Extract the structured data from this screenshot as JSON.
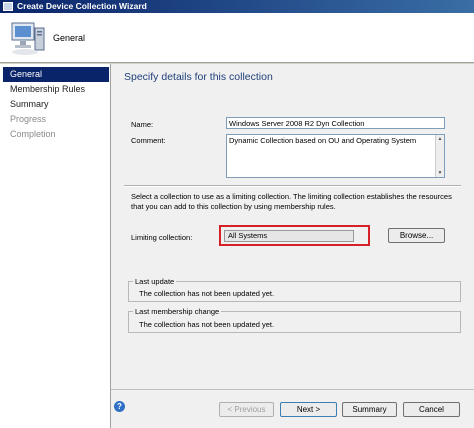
{
  "window": {
    "title": "Create Device Collection Wizard"
  },
  "header": {
    "title": "General"
  },
  "sidebar": {
    "items": [
      {
        "label": "General",
        "state": "active"
      },
      {
        "label": "Membership Rules",
        "state": "normal"
      },
      {
        "label": "Summary",
        "state": "normal"
      },
      {
        "label": "Progress",
        "state": "disabled"
      },
      {
        "label": "Completion",
        "state": "disabled"
      }
    ]
  },
  "main": {
    "title": "Specify details for this collection",
    "name_label": "Name:",
    "name_value": "Windows Server 2008 R2 Dyn Collection",
    "comment_label": "Comment:",
    "comment_value": "Dynamic Collection based on OU and Operating System",
    "limiting_description": "Select a collection to use as a limiting collection. The limiting collection establishes the resources that you can add to this collection by using membership rules.",
    "limiting_label": "Limiting collection:",
    "limiting_value": "All Systems",
    "browse_label": "Browse...",
    "last_update_legend": "Last update",
    "last_update_text": "The collection has not been updated yet.",
    "last_change_legend": "Last membership change",
    "last_change_text": "The collection has not been updated yet."
  },
  "footer": {
    "previous_label": "< Previous",
    "next_label": "Next >",
    "summary_label": "Summary",
    "cancel_label": "Cancel"
  },
  "colors": {
    "accent": "#0a246a",
    "highlight": "#d61f26",
    "title_text": "#1f3f7a"
  }
}
